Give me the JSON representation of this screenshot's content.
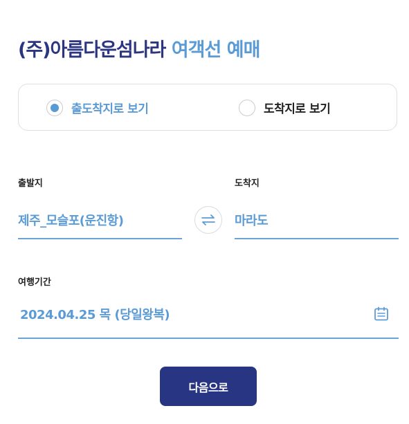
{
  "header": {
    "company": "(주)아름다운섬나라",
    "service": "여객선 예매"
  },
  "view_toggle": {
    "options": [
      {
        "label": "출도착지로 보기",
        "selected": true
      },
      {
        "label": "도착지로 보기",
        "selected": false
      }
    ]
  },
  "route": {
    "departure_label": "출발지",
    "departure_value": "제주_모슬포(운진항)",
    "arrival_label": "도착지",
    "arrival_value": "마라도",
    "swap_icon": "swap-arrows-icon"
  },
  "period": {
    "label": "여행기간",
    "value": "2024.04.25 목 (당일왕복)",
    "icon": "calendar-icon"
  },
  "actions": {
    "next_label": "다음으로"
  },
  "colors": {
    "navy": "#283582",
    "accent": "#5b9bd5",
    "border": "#dcdfe6"
  }
}
